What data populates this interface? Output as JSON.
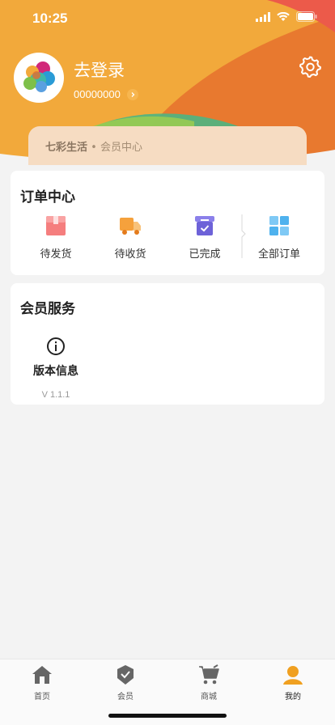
{
  "status_bar": {
    "time": "10:25"
  },
  "profile": {
    "login_label": "去登录",
    "user_id": "00000000",
    "settings_icon": "gear-icon"
  },
  "member_strip": {
    "brand": "七彩生活",
    "separator": " • ",
    "label": "会员中心"
  },
  "orders": {
    "title": "订单中心",
    "items": [
      {
        "label": "待发货",
        "icon": "package-icon"
      },
      {
        "label": "待收货",
        "icon": "truck-icon"
      },
      {
        "label": "已完成",
        "icon": "box-check-icon"
      },
      {
        "label": "全部订单",
        "icon": "grid-icon"
      }
    ]
  },
  "services": {
    "title": "会员服务",
    "items": [
      {
        "label": "版本信息",
        "sub": "V 1.1.1",
        "icon": "info-icon"
      }
    ]
  },
  "tabbar": {
    "items": [
      {
        "label": "首页",
        "icon": "home-icon",
        "active": false
      },
      {
        "label": "会员",
        "icon": "member-badge-icon",
        "active": false
      },
      {
        "label": "商城",
        "icon": "cart-icon",
        "active": false
      },
      {
        "label": "我的",
        "icon": "user-icon",
        "active": true
      }
    ]
  },
  "colors": {
    "header_orange": "#f2a93b",
    "header_dark_orange": "#e8792f",
    "accent_active": "#f0a020",
    "strip_bg": "#f6dcc2"
  }
}
